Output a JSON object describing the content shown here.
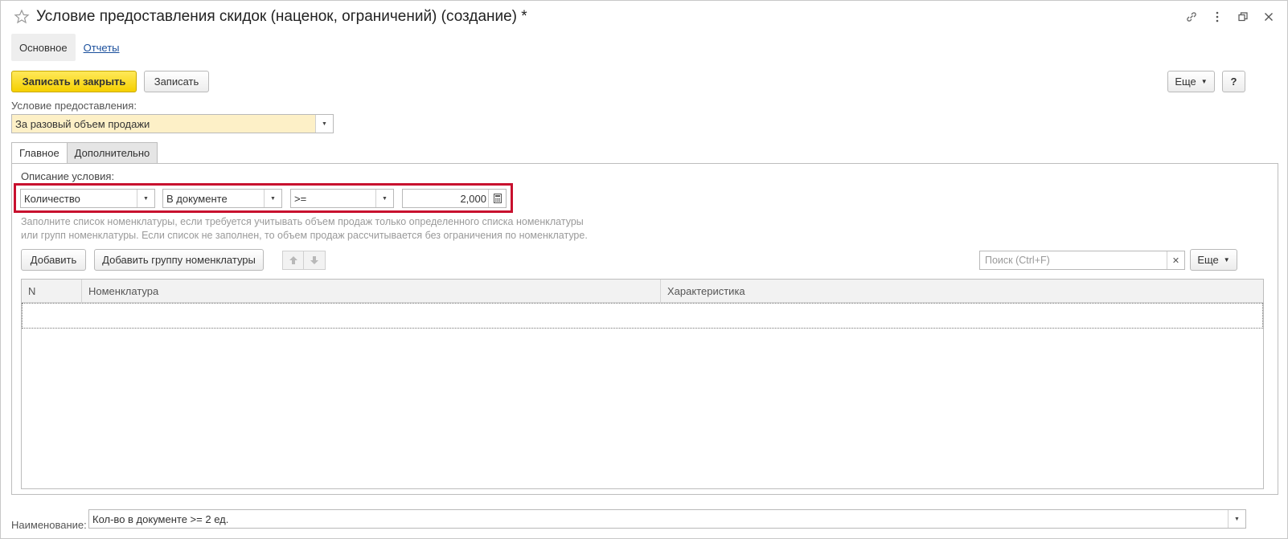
{
  "window": {
    "title": "Условие предоставления скидок (наценок, ограничений) (создание) *"
  },
  "nav": {
    "main": "Основное",
    "reports": "Отчеты"
  },
  "toolbar": {
    "save_close": "Записать и закрыть",
    "save": "Записать",
    "more": "Еще",
    "help": "?"
  },
  "condition": {
    "label": "Условие предоставления:",
    "value": "За разовый объем продажи"
  },
  "tabs": {
    "main": "Главное",
    "extra": "Дополнительно"
  },
  "description": {
    "label": "Описание условия:",
    "field1": "Количество",
    "field2": "В документе",
    "field3": ">=",
    "amount": "2,000"
  },
  "hint": {
    "line1": "Заполните список номенклатуры, если требуется учитывать объем продаж только определенного списка номенклатуры",
    "line2": "или групп номенклатуры. Если список не заполнен, то объем продаж рассчитывается без ограничения по номенклатуре."
  },
  "list_toolbar": {
    "add": "Добавить",
    "add_group": "Добавить группу номенклатуры",
    "search_placeholder": "Поиск (Ctrl+F)",
    "more": "Еще"
  },
  "table": {
    "columns": [
      "N",
      "Номенклатура",
      "Характеристика"
    ]
  },
  "name_field": {
    "label": "Наименование:",
    "value": "Кол-во в документе >= 2 ед."
  },
  "colors": {
    "accent": "#f5d000",
    "highlight": "#c8102e",
    "link": "#1a4f9c"
  }
}
